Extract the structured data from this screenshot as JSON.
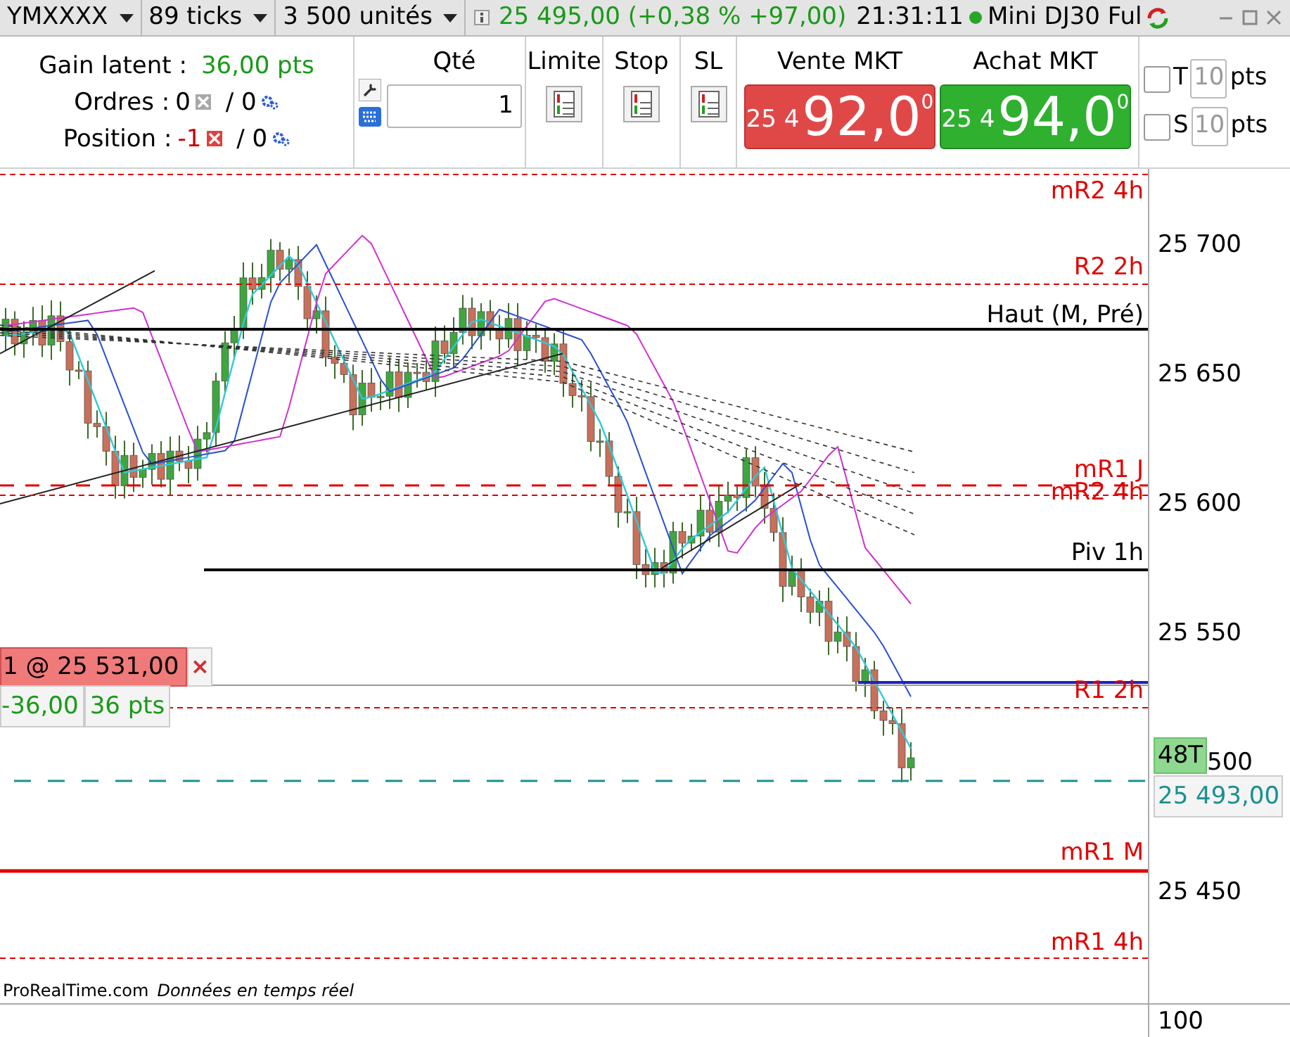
{
  "top_bar": {
    "dropdowns": [
      "YMXXXX",
      "89 ticks",
      "3 500 unités"
    ],
    "quote": "25 495,00 (+0,38 % +97,00)",
    "time": "21:31:11",
    "instrument": "Mini DJ30 Ful"
  },
  "summary": {
    "gain_label": "Gain latent :",
    "gain_value": "36,00 pts",
    "orders_label": "Ordres :",
    "orders_a": "0",
    "orders_b": "/ 0",
    "position_label": "Position :",
    "position_a": "-1",
    "position_b": "/ 0"
  },
  "order_ticket": {
    "qty_label": "Qté",
    "qty_value": "1",
    "order_types": [
      "Limite",
      "Stop",
      "SL"
    ],
    "sell": {
      "label": "Vente MKT",
      "prefix": "25 4",
      "main": "92,0",
      "sup": "0"
    },
    "buy": {
      "label": "Achat MKT",
      "prefix": "25 4",
      "main": "94,0",
      "sup": "0"
    },
    "options": [
      {
        "label": "T",
        "checked": false,
        "value": "10",
        "unit": "pts"
      },
      {
        "label": "S",
        "checked": false,
        "value": "10",
        "unit": "pts"
      }
    ]
  },
  "levels": [
    {
      "label": "mR2 4h",
      "color": "#e00000"
    },
    {
      "label": "R2 2h",
      "color": "#e00000"
    },
    {
      "label": "Haut (M, Pré)",
      "color": "#000000"
    },
    {
      "label": "mR1 J",
      "color": "#e00000"
    },
    {
      "label": "mR2 4h",
      "color": "#e00000"
    },
    {
      "label": "Piv 1h",
      "color": "#000000"
    },
    {
      "label": "R1 2h",
      "color": "#e00000"
    },
    {
      "label": "mR1 M",
      "color": "#e00000"
    },
    {
      "label": "mR1 4h",
      "color": "#e00000"
    }
  ],
  "position_tag": {
    "order": "1 @ 25 531,00",
    "close": "×",
    "pnl": "-36,00",
    "points": "36 pts"
  },
  "price_axis": {
    "ticks": [
      "25 700",
      "25 650",
      "25 600",
      "25 550",
      "500",
      "25 450"
    ],
    "tick_badge": "48T",
    "last_price": "25 493,00"
  },
  "footer": {
    "source": "ProRealTime.com",
    "note": "Données en temps réel"
  },
  "lower_pane": {
    "tick": "100"
  }
}
